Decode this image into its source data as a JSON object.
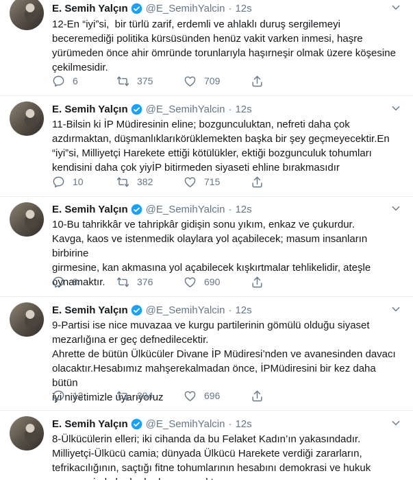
{
  "author": {
    "name": "E. Semih Yalçın",
    "handle": "@E_SemihYalcin",
    "time": "12s"
  },
  "tweets": [
    {
      "text": "12-En “iyi”si,  bir türlü zarif, erdemli ve ahlaklı duruş sergilemeyi\nbeceremediği politika kürsüsünden henüz vakit varken inmesi, haşre\nyürümeden önce ahir ömründe torunlarıyla haşırneşir olmak üzere köşesine\nçekilmesidir.",
      "replies": "6",
      "retweets": "375",
      "likes": "709"
    },
    {
      "text": "11-Bilsin ki İP Müdiresinin eline; bozgunculuktan, nefreti daha çok\nazdırmaktan, düşmanlıklarıkörüklemekten başka bir şey geçmeyecektir.En\n“iyi”si, Milliyetçi Harekete ettiği kötülükler, ektiği bozgunculuk tohumları\nkendisini daha çok yiyİP bitirmeden siyaseti ehline bırakmasıdır",
      "replies": "10",
      "retweets": "382",
      "likes": "715"
    },
    {
      "text": "10-Bu tahrikkâr ve tahripkâr gidişin sonu yıkım, enkaz ve çukurdur.\nKavga, kaos ve istenmedik olaylara yol açabilecek; masum insanların birbirine\ngirmesine, kan akmasına yol açabilecek kışkırtmalar tehlikelidir, ateşle\noynamaktır.",
      "replies": "8",
      "retweets": "376",
      "likes": "690"
    },
    {
      "text": "9-Partisi ise nice muvazaa ve kurgu partilerinin gömülü olduğu siyaset\nmezarlığına er geç defnedilecektir.\nAhrette de bütün Ülkücüler Divane İP Müdiresi’nden ve avanesinden davacı\nolacaktır.Hesabımız mahşerekalmadan önce, İPMüdiresini bir kez daha bütün\niyi niyetimizle uyarıyoruz",
      "replies": "13",
      "retweets": "394",
      "likes": "696"
    },
    {
      "text": "8-Ülkücülerin elleri; iki cihanda da bu Felaket Kadın’ın yakasındadır.\nMilliyetçi-Ülkücü camia; dünyada Ülkücü Harekete verdiği zararların,\ntefrikacılığının, saçtığı fitne tohumlarının hesabını demokrasi ve hukuk\nçerçevesinde bu kadından soracaktır.",
      "replies": "",
      "retweets": "",
      "likes": ""
    }
  ],
  "colors": {
    "text": "#14171a",
    "muted": "#657786",
    "verified": "#1da1f2",
    "border": "#e6ecf0"
  },
  "icons": [
    "verified-badge-icon",
    "chevron-down-icon",
    "reply-icon",
    "retweet-icon",
    "like-icon",
    "share-icon"
  ]
}
